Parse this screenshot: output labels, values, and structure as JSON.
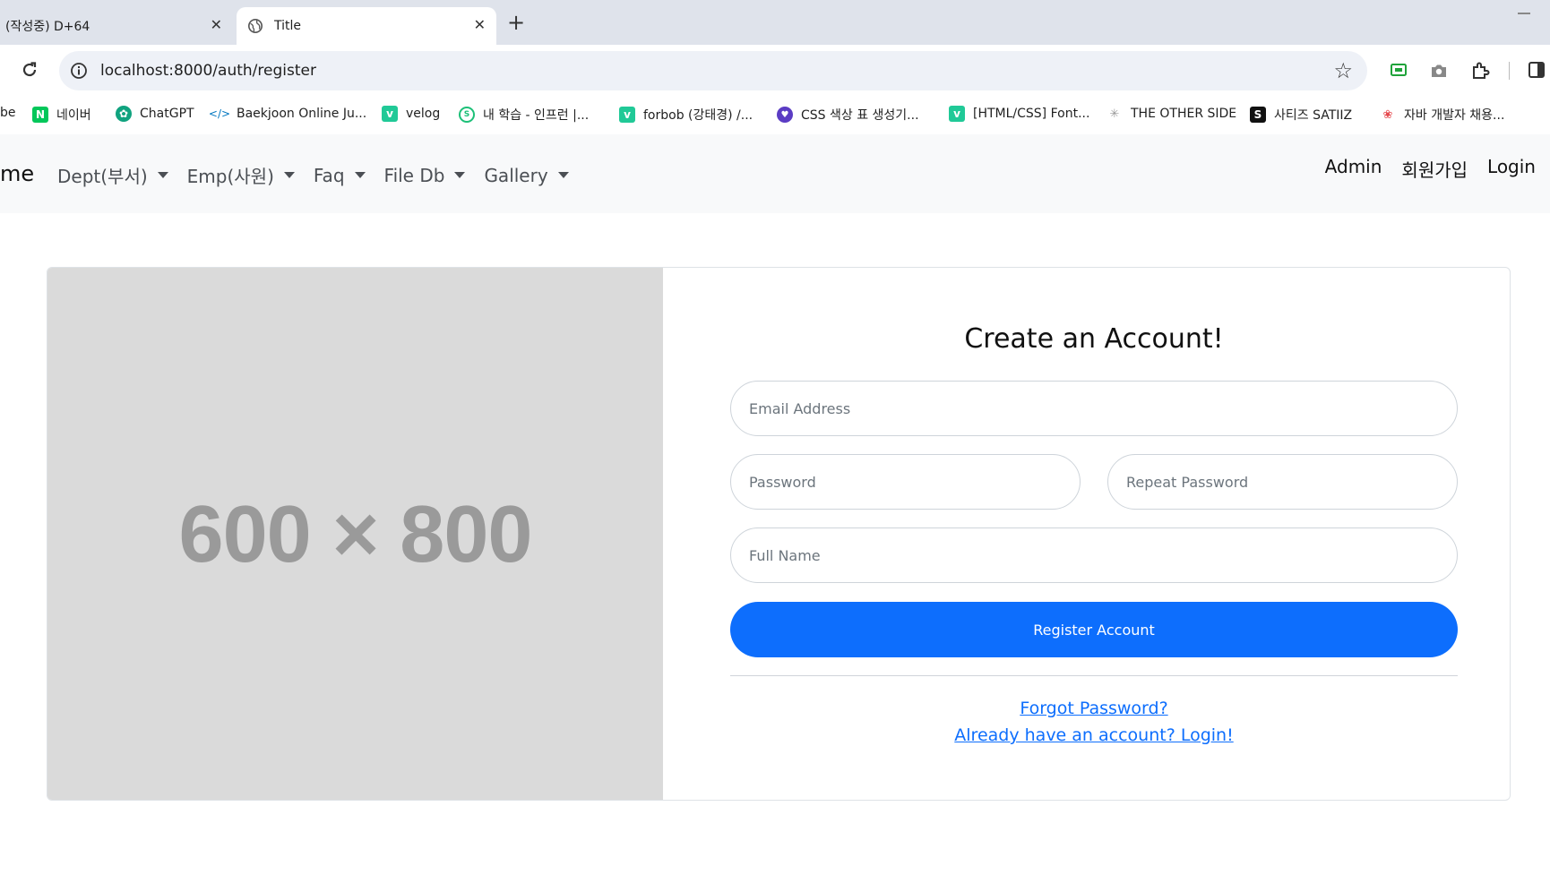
{
  "browser": {
    "tabs": [
      {
        "title": "(작성중) D+64",
        "active": false
      },
      {
        "title": "Title",
        "active": true
      }
    ],
    "new_tab_symbol": "+",
    "close_symbol": "✕",
    "url": "localhost:8000/auth/register",
    "bookmarks": [
      {
        "label": "be",
        "icon": "youtube-icon"
      },
      {
        "label": "네이버",
        "icon": "naver-icon",
        "color": "#03c75a",
        "glyph": "N"
      },
      {
        "label": "ChatGPT",
        "icon": "chatgpt-icon",
        "color": "#10a37f"
      },
      {
        "label": "Baekjoon Online Ju...",
        "icon": "baekjoon-icon",
        "color": "#0076c0",
        "glyph": "</>"
      },
      {
        "label": "velog",
        "icon": "velog-icon",
        "color": "#20c997",
        "glyph": "v"
      },
      {
        "label": "내 학습 - 인프런 |...",
        "icon": "inflearn-icon",
        "color": "#1dc078"
      },
      {
        "label": "forbob (강태경) /...",
        "icon": "velog-icon",
        "color": "#20c997",
        "glyph": "v"
      },
      {
        "label": "CSS 색상 표 생성기...",
        "icon": "css-tool-icon",
        "color": "#5b3cc4"
      },
      {
        "label": "[HTML/CSS] Font...",
        "icon": "velog-icon",
        "color": "#20c997",
        "glyph": "v"
      },
      {
        "label": "THE OTHER SIDE",
        "icon": "other-side-icon",
        "color": "#999999"
      },
      {
        "label": "사티즈 SATIIZ",
        "icon": "satiiz-icon",
        "color": "#111111",
        "glyph": "S"
      },
      {
        "label": "자바 개발자 채용...",
        "icon": "jobsite-icon",
        "color": "#e5484d"
      }
    ]
  },
  "navbar": {
    "brand": "me",
    "menus": [
      "Dept(부서)",
      "Emp(사원)",
      "Faq",
      "File Db",
      "Gallery"
    ],
    "right_links": [
      "Admin",
      "회원가입",
      "Login"
    ]
  },
  "register": {
    "image_placeholder": "600 × 800",
    "title": "Create an Account!",
    "email_placeholder": "Email Address",
    "password_placeholder": "Password",
    "repeat_password_placeholder": "Repeat Password",
    "fullname_placeholder": "Full Name",
    "submit_label": "Register Account",
    "forgot_link": "Forgot Password?",
    "login_link": "Already have an account? Login!"
  },
  "colors": {
    "primary": "#0d6efd",
    "navbar_bg": "#f8f9fa",
    "placeholder_bg": "#dadada"
  }
}
